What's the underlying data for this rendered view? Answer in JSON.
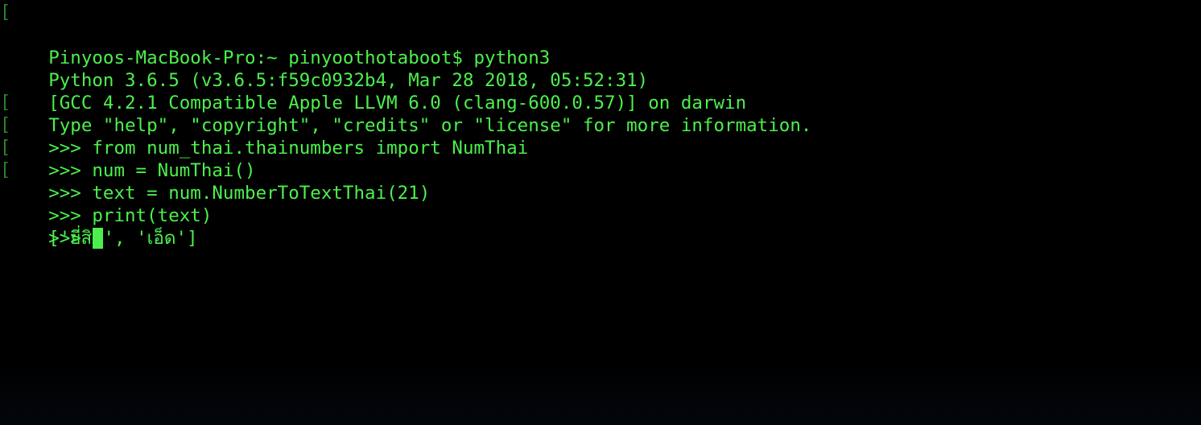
{
  "terminal": {
    "lines": [
      {
        "marker": "[",
        "text": "Pinyoos-MacBook-Pro:~ pinyoothotaboot$ python3"
      },
      {
        "marker": "",
        "text": "Python 3.6.5 (v3.6.5:f59c0932b4, Mar 28 2018, 05:52:31)"
      },
      {
        "marker": "",
        "text": "[GCC 4.2.1 Compatible Apple LLVM 6.0 (clang-600.0.57)] on darwin"
      },
      {
        "marker": "",
        "text": "Type \"help\", \"copyright\", \"credits\" or \"license\" for more information."
      },
      {
        "marker": "[",
        "text": ">>> from num_thai.thainumbers import NumThai"
      },
      {
        "marker": "[",
        "text": ">>> num = NumThai()"
      },
      {
        "marker": "[",
        "text": ">>> text = num.NumberToTextThai(21)"
      },
      {
        "marker": "[",
        "text": ">>> print(text)"
      },
      {
        "marker": "",
        "text": "['ยี่สิบ', 'เอ็ด']"
      }
    ],
    "prompt": ">>> ",
    "colors": {
      "background": "#000000",
      "foreground": "#4cf04c",
      "cursor": "#4cf04c"
    }
  }
}
